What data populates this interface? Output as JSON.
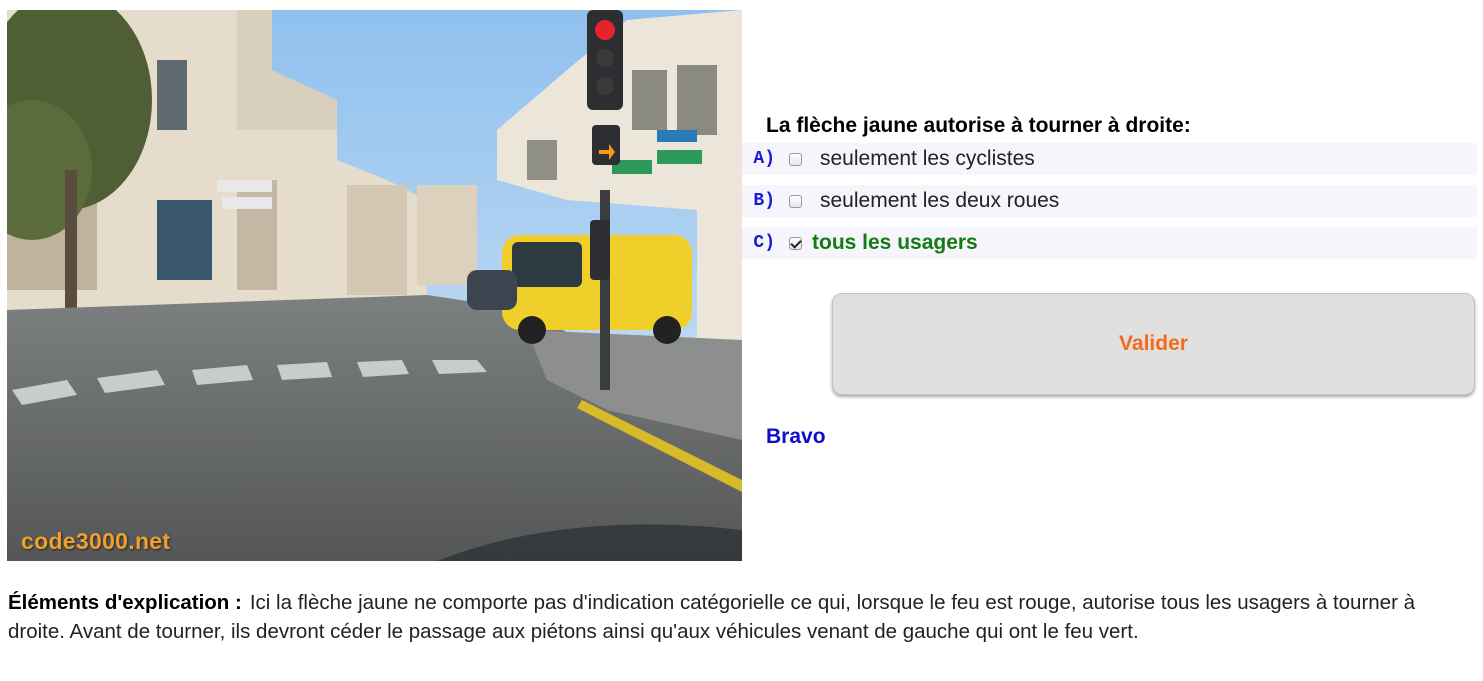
{
  "photo": {
    "watermark": "code3000.net"
  },
  "quiz": {
    "question": "La flèche jaune autorise à tourner à droite:",
    "answers": [
      {
        "letter": "A)",
        "text": "seulement les cyclistes",
        "checked": false
      },
      {
        "letter": "B)",
        "text": "seulement les deux roues",
        "checked": false
      },
      {
        "letter": "C)",
        "text": "tous les usagers",
        "checked": true
      }
    ],
    "validate_label": "Valider",
    "feedback": "Bravo"
  },
  "explanation": {
    "label": "Éléments d'explication :",
    "text": "Ici la flèche jaune ne comporte pas d'indication catégorielle ce qui, lorsque le feu est rouge, autorise tous les usagers à tourner à droite. Avant de tourner, ils devront céder le passage aux piétons ainsi qu'aux véhicules venant de gauche qui ont le feu vert."
  },
  "colors": {
    "question_letter": "#1a1ad8",
    "correct_answer": "#137b13",
    "validate_text": "#f36c1c",
    "feedback": "#0d0dd0",
    "watermark": "#f0a02a"
  }
}
